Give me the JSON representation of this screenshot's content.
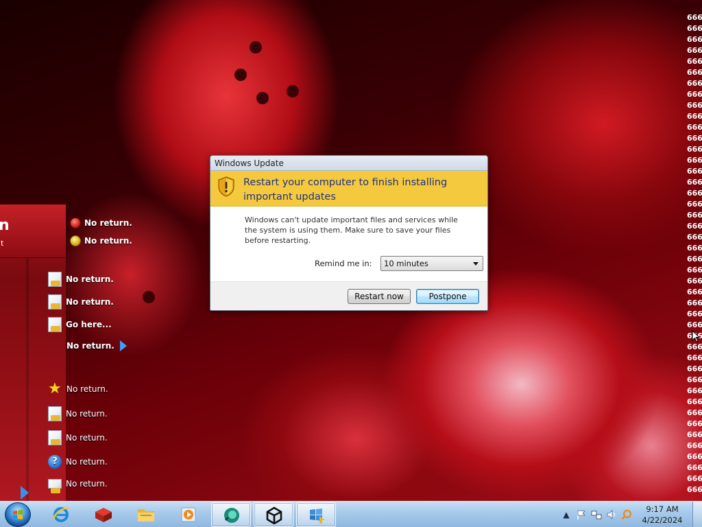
{
  "wallpaper": {
    "repeated_text": [
      "666",
      "666",
      "666",
      "666",
      "666",
      "666",
      "666",
      "666",
      "666",
      "666",
      "666",
      "666",
      "666",
      "666",
      "666",
      "666",
      "666",
      "666",
      "666",
      "666",
      "666",
      "666",
      "666",
      "666",
      "666",
      "666",
      "666",
      "666",
      "666",
      "666",
      "666",
      "666",
      "666",
      "666",
      "666",
      "666",
      "666",
      "666",
      "666",
      "666",
      "666",
      "666",
      "666",
      "666"
    ]
  },
  "start_panel": {
    "header_title": "n",
    "header_subtitle": "'t",
    "top_items": [
      {
        "icon": "red-warning-icon",
        "label": "No return."
      },
      {
        "icon": "yellow-warning-icon",
        "label": "No return."
      }
    ],
    "items": [
      {
        "icon": "document-icon",
        "label": "No return."
      },
      {
        "icon": "document-icon",
        "label": "No return."
      },
      {
        "icon": "folder-icon",
        "label": "Go here..."
      },
      {
        "icon": "arrow-icon",
        "label": "No return."
      },
      {
        "icon": "star-icon",
        "label": "No  return."
      },
      {
        "icon": "search-folder-icon",
        "label": "No  return."
      },
      {
        "icon": "checklist-icon",
        "label": "No  return."
      },
      {
        "icon": "help-icon",
        "label": "No  return."
      },
      {
        "icon": "run-icon",
        "label": "No  return."
      }
    ]
  },
  "dialog": {
    "title": "Windows Update",
    "headline": "Restart your computer to finish installing important updates",
    "description": "Windows can't update important files and services while the system is using them. Make sure to save your files before restarting.",
    "remind_label": "Remind me in:",
    "remind_value": "10 minutes",
    "restart_label": "Restart now",
    "postpone_label": "Postpone",
    "colors": {
      "banner": "#f5c93e",
      "headline": "#1e3287"
    }
  },
  "taskbar": {
    "apps": [
      {
        "name": "internet-explorer",
        "icon": "ie-icon"
      },
      {
        "name": "app-red",
        "icon": "red-box-icon"
      },
      {
        "name": "file-explorer",
        "icon": "folder-icon"
      },
      {
        "name": "media-player",
        "icon": "media-icon"
      },
      {
        "name": "app-green",
        "icon": "green-circle-icon"
      },
      {
        "name": "unity",
        "icon": "unity-icon"
      },
      {
        "name": "windows-update",
        "icon": "update-icon"
      }
    ],
    "time": "9:17 AM",
    "date": "4/22/2024"
  }
}
